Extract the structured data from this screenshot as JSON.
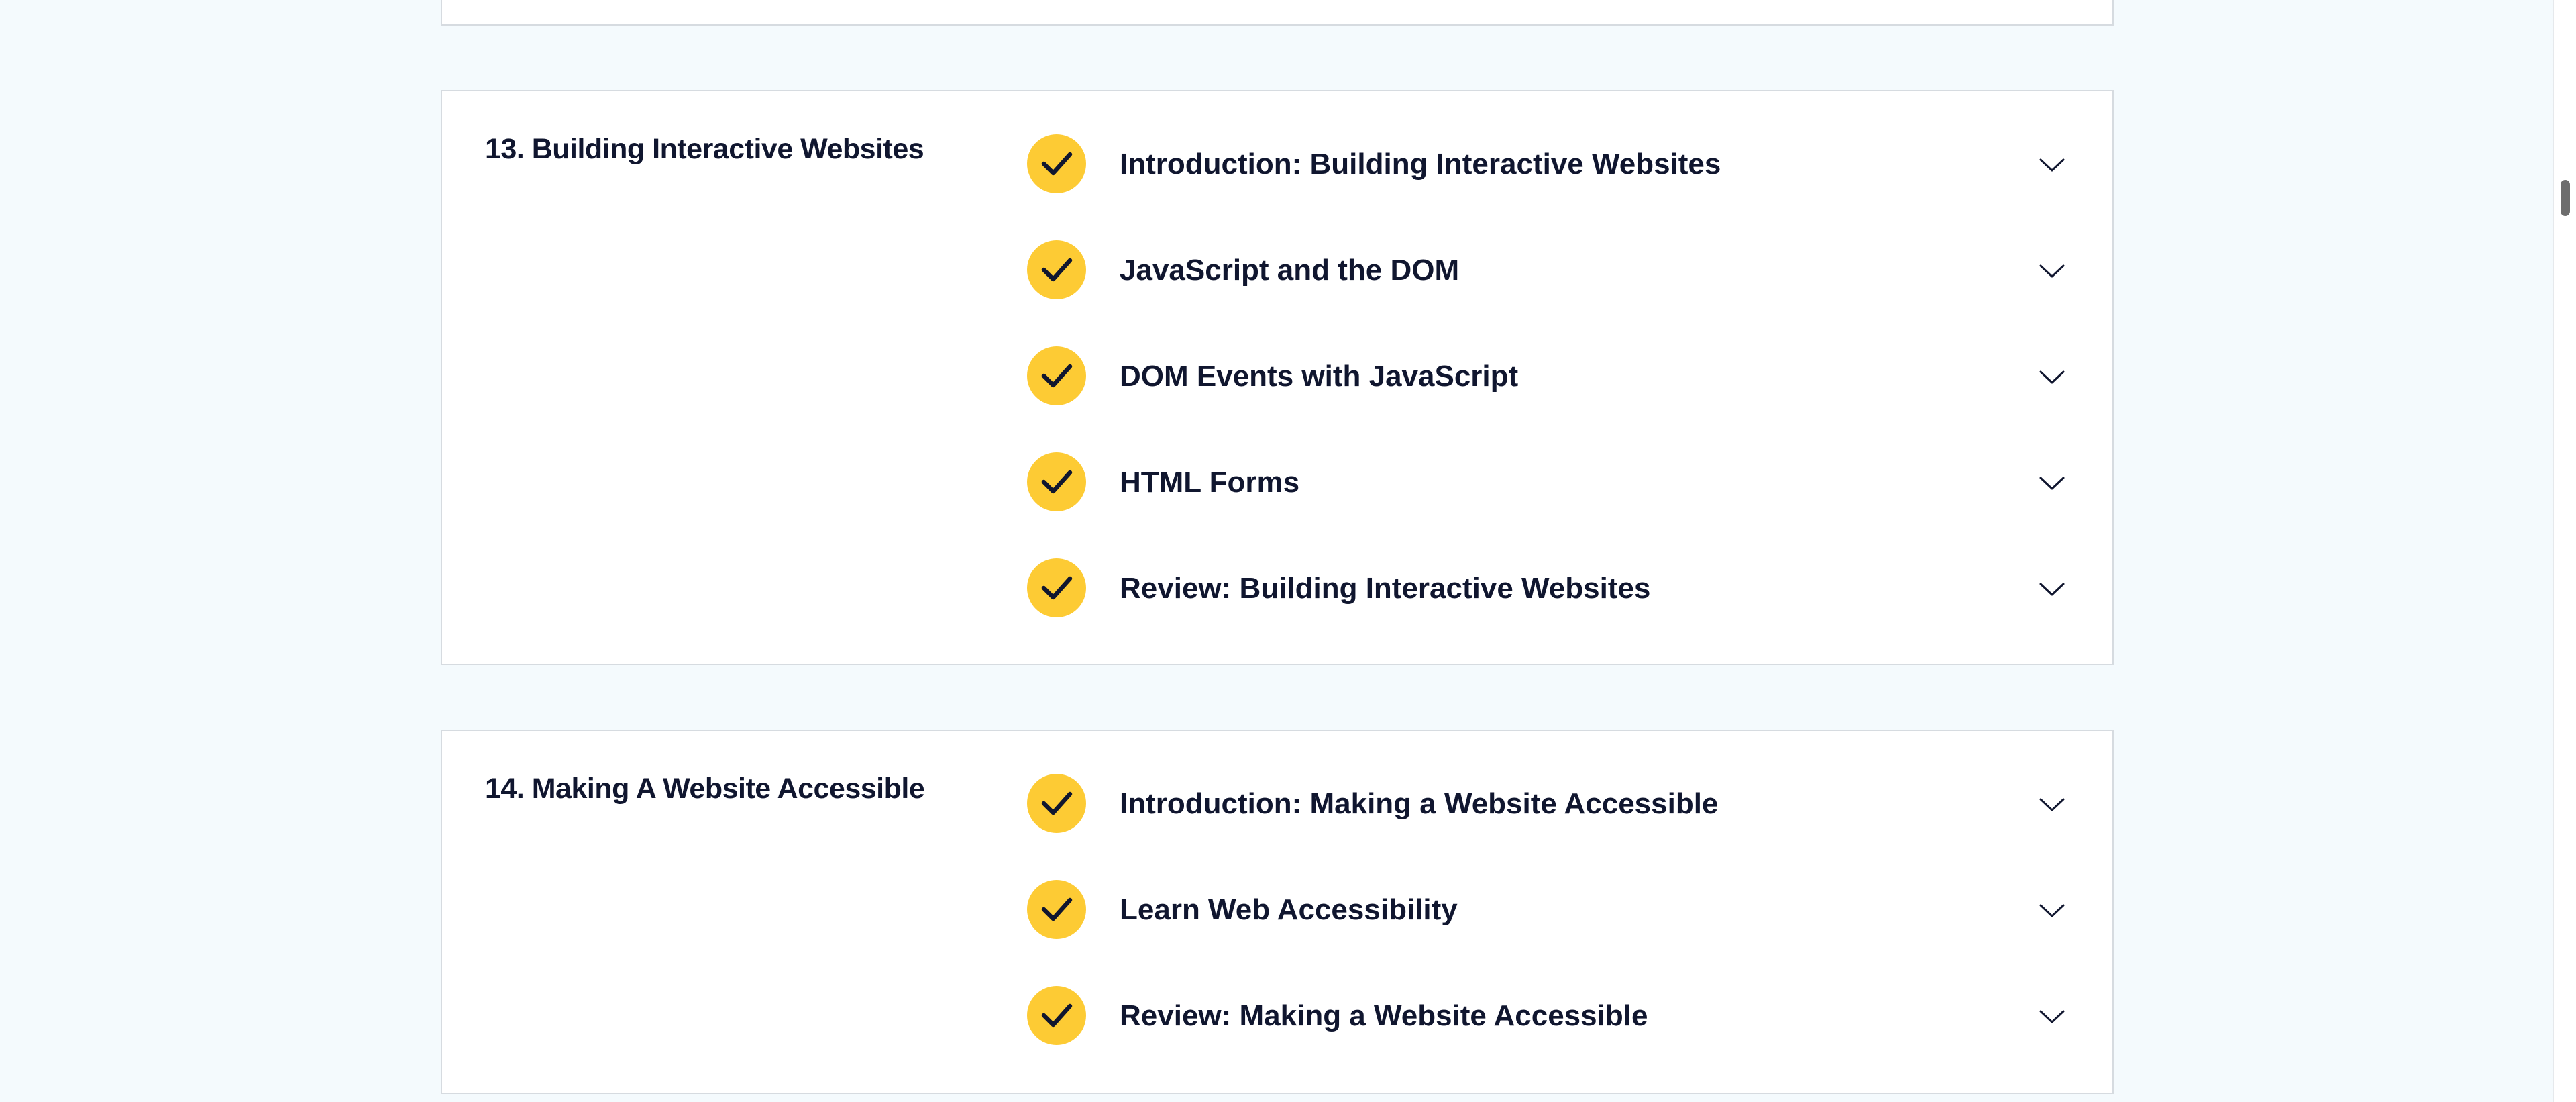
{
  "colors": {
    "page_background": "#f4fafd",
    "card_background": "#ffffff",
    "card_border": "#d6dbe0",
    "text": "#10162f",
    "check_badge": "#fdcb34"
  },
  "icons": {
    "complete": "checkmark-icon",
    "expand": "chevron-down-icon"
  },
  "modules": [
    {
      "title": "13. Building Interactive Websites",
      "lessons": [
        {
          "label": "Introduction: Building Interactive Websites",
          "completed": true
        },
        {
          "label": "JavaScript and the DOM",
          "completed": true
        },
        {
          "label": "DOM Events with JavaScript",
          "completed": true
        },
        {
          "label": "HTML Forms",
          "completed": true
        },
        {
          "label": "Review: Building Interactive Websites",
          "completed": true
        }
      ]
    },
    {
      "title": "14. Making A Website Accessible",
      "lessons": [
        {
          "label": "Introduction: Making a Website Accessible",
          "completed": true
        },
        {
          "label": "Learn Web Accessibility",
          "completed": true
        },
        {
          "label": "Review: Making a Website Accessible",
          "completed": true
        }
      ]
    }
  ]
}
